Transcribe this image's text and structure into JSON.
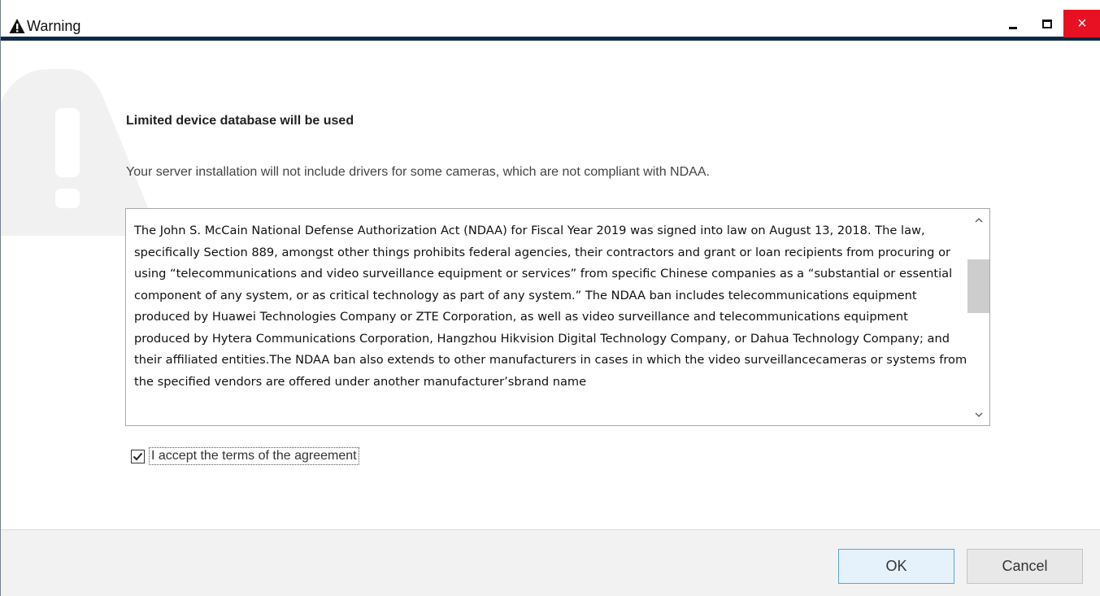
{
  "window": {
    "title": "Warning",
    "title_icon": "warning-triangle-icon",
    "controls": {
      "minimize_icon": "minimize-icon",
      "maximize_icon": "maximize-icon",
      "close_icon": "close-icon",
      "close_symbol": "×"
    }
  },
  "content": {
    "background_icon": "warning-exclamation-icon",
    "heading": "Limited device database will be used",
    "description": "Your server installation will not include drivers for some cameras, which are not compliant with NDAA.",
    "terms_text": "The John S. McCain National Defense Authorization Act (NDAA) for Fiscal Year 2019 was signed into law on August 13, 2018. The law, specifically Section 889, amongst other things prohibits federal agencies, their contractors and grant or loan recipients from procuring or using “telecommunications and video surveillance equipment or services” from specific Chinese companies as a “substantial or essential component of any system, or as critical technology as part of any system.” The NDAA ban includes telecommunications equipment produced by Huawei Technologies Company or ZTE Corporation, as well as video surveillance and telecommunications equipment produced by Hytera Communications Corporation, Hangzhou Hikvision Digital Technology Company, or Dahua Technology Company; and their affiliated entities.The NDAA ban also extends to other manufacturers in cases in which the video surveillancecameras or systems from the specified vendors are offered under another manufacturer’sbrand name",
    "scroll_up_symbol": "^",
    "scroll_down_symbol": "v",
    "accept": {
      "label": "I accept the terms of the agreement",
      "checked": true
    }
  },
  "footer": {
    "ok_label": "OK",
    "cancel_label": "Cancel"
  },
  "colors": {
    "title_border": "#0e2a47",
    "close_button": "#e81123",
    "ok_border": "#56a6dd",
    "footer_bg": "#f2f2f2"
  }
}
